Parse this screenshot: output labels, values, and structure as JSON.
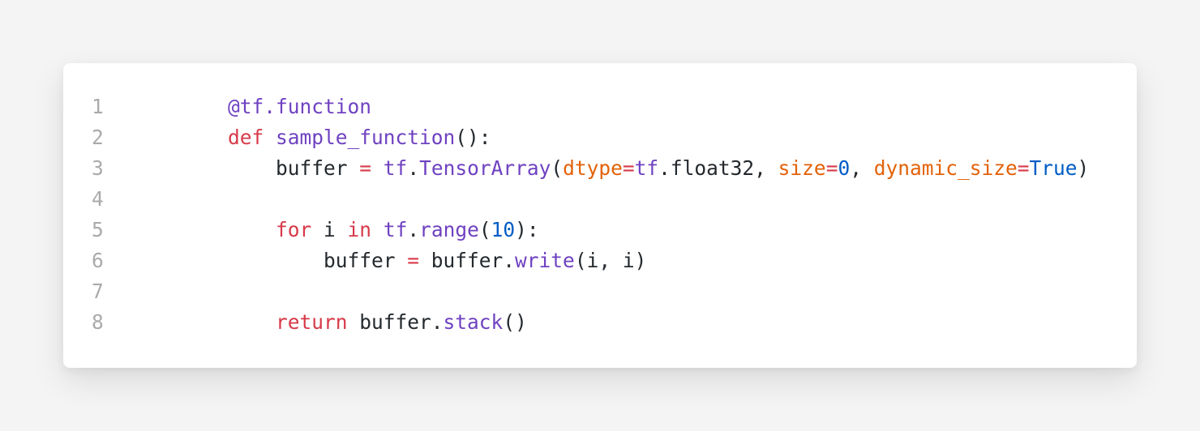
{
  "colors": {
    "background": "#f4f4f4",
    "card": "#ffffff",
    "line_number": "#aaaaaa",
    "plain": "#24292e",
    "keyword": "#d73a49",
    "function": "#6f42c1",
    "parameter": "#e36209",
    "number": "#005cc5"
  },
  "code": {
    "lines": [
      {
        "number": "1",
        "tokens": [
          {
            "type": "deco",
            "text": "@tf.function"
          }
        ]
      },
      {
        "number": "2",
        "tokens": [
          {
            "type": "kw",
            "text": "def"
          },
          {
            "type": "plain",
            "text": " "
          },
          {
            "type": "fn",
            "text": "sample_function"
          },
          {
            "type": "plain",
            "text": "():"
          }
        ]
      },
      {
        "number": "3",
        "tokens": [
          {
            "type": "plain",
            "text": "    buffer "
          },
          {
            "type": "op",
            "text": "="
          },
          {
            "type": "plain",
            "text": " "
          },
          {
            "type": "mod",
            "text": "tf"
          },
          {
            "type": "plain",
            "text": "."
          },
          {
            "type": "fn",
            "text": "TensorArray"
          },
          {
            "type": "plain",
            "text": "("
          },
          {
            "type": "param",
            "text": "dtype"
          },
          {
            "type": "op",
            "text": "="
          },
          {
            "type": "mod",
            "text": "tf"
          },
          {
            "type": "plain",
            "text": ".float32, "
          },
          {
            "type": "param",
            "text": "size"
          },
          {
            "type": "op",
            "text": "="
          },
          {
            "type": "num",
            "text": "0"
          },
          {
            "type": "plain",
            "text": ", "
          },
          {
            "type": "param",
            "text": "dynamic_size"
          },
          {
            "type": "op",
            "text": "="
          },
          {
            "type": "const",
            "text": "True"
          },
          {
            "type": "plain",
            "text": ")"
          }
        ]
      },
      {
        "number": "4",
        "tokens": []
      },
      {
        "number": "5",
        "tokens": [
          {
            "type": "plain",
            "text": "    "
          },
          {
            "type": "kw",
            "text": "for"
          },
          {
            "type": "plain",
            "text": " i "
          },
          {
            "type": "kw",
            "text": "in"
          },
          {
            "type": "plain",
            "text": " "
          },
          {
            "type": "mod",
            "text": "tf"
          },
          {
            "type": "plain",
            "text": "."
          },
          {
            "type": "fn",
            "text": "range"
          },
          {
            "type": "plain",
            "text": "("
          },
          {
            "type": "num",
            "text": "10"
          },
          {
            "type": "plain",
            "text": "):"
          }
        ]
      },
      {
        "number": "6",
        "tokens": [
          {
            "type": "plain",
            "text": "        buffer "
          },
          {
            "type": "op",
            "text": "="
          },
          {
            "type": "plain",
            "text": " buffer."
          },
          {
            "type": "fn",
            "text": "write"
          },
          {
            "type": "plain",
            "text": "(i, i)"
          }
        ]
      },
      {
        "number": "7",
        "tokens": []
      },
      {
        "number": "8",
        "tokens": [
          {
            "type": "plain",
            "text": "    "
          },
          {
            "type": "kw",
            "text": "return"
          },
          {
            "type": "plain",
            "text": " buffer."
          },
          {
            "type": "fn",
            "text": "stack"
          },
          {
            "type": "plain",
            "text": "()"
          }
        ]
      }
    ]
  }
}
